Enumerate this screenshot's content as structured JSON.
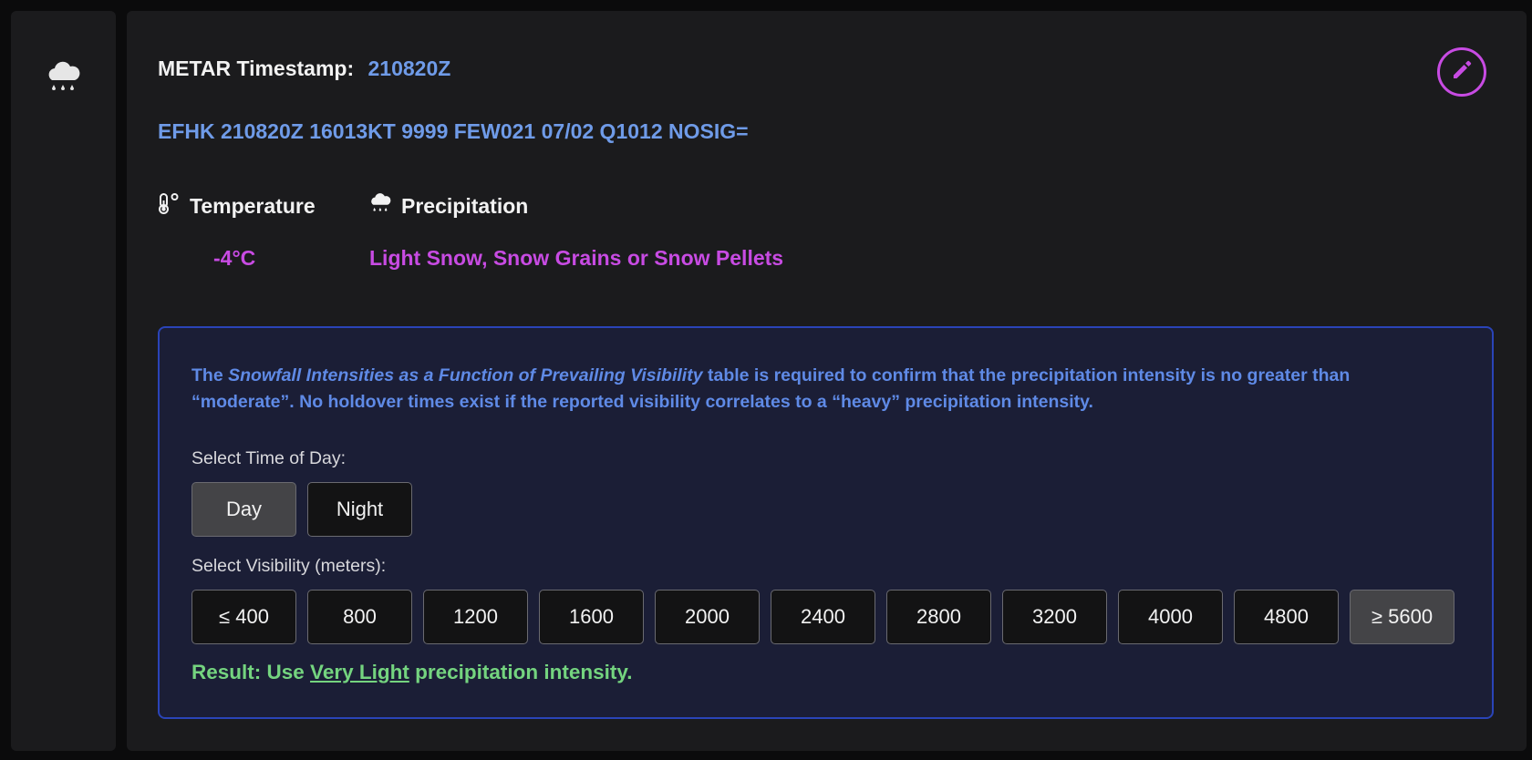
{
  "icons": {
    "sidebar": "cloud-rain-icon",
    "edit": "pencil-icon",
    "temperature": "thermometer-icon",
    "precipitation": "cloud-rain-icon"
  },
  "colors": {
    "accent_blue": "#6f9be8",
    "accent_magenta": "#c84be3",
    "result_green": "#74d47f",
    "box_border": "#2a44b8"
  },
  "header": {
    "timestamp_label": "METAR Timestamp:",
    "timestamp_value": "210820Z"
  },
  "metar_text": "EFHK 210820Z 16013KT 9999 FEW021 07/02 Q1012 NOSIG=",
  "conditions": {
    "temperature": {
      "label": "Temperature",
      "value": "-4°C"
    },
    "precipitation": {
      "label": "Precipitation",
      "value": "Light Snow, Snow Grains or Snow Pellets"
    }
  },
  "notice": {
    "prefix": "The ",
    "table_name": "Snowfall Intensities as a Function of Prevailing Visibility",
    "suffix": " table is required to confirm that the precipitation intensity is no greater than “moderate”. No holdover times exist if the reported visibility correlates to a “heavy” precipitation intensity."
  },
  "time_of_day": {
    "label": "Select Time of Day:",
    "options": [
      "Day",
      "Night"
    ],
    "selected": "Day"
  },
  "visibility": {
    "label": "Select Visibility (meters):",
    "options": [
      "≤ 400",
      "800",
      "1200",
      "1600",
      "2000",
      "2400",
      "2800",
      "3200",
      "4000",
      "4800",
      "≥ 5600"
    ],
    "selected": "≥ 5600"
  },
  "result": {
    "prefix": "Result: Use ",
    "intensity": "Very Light",
    "suffix": " precipitation intensity."
  }
}
